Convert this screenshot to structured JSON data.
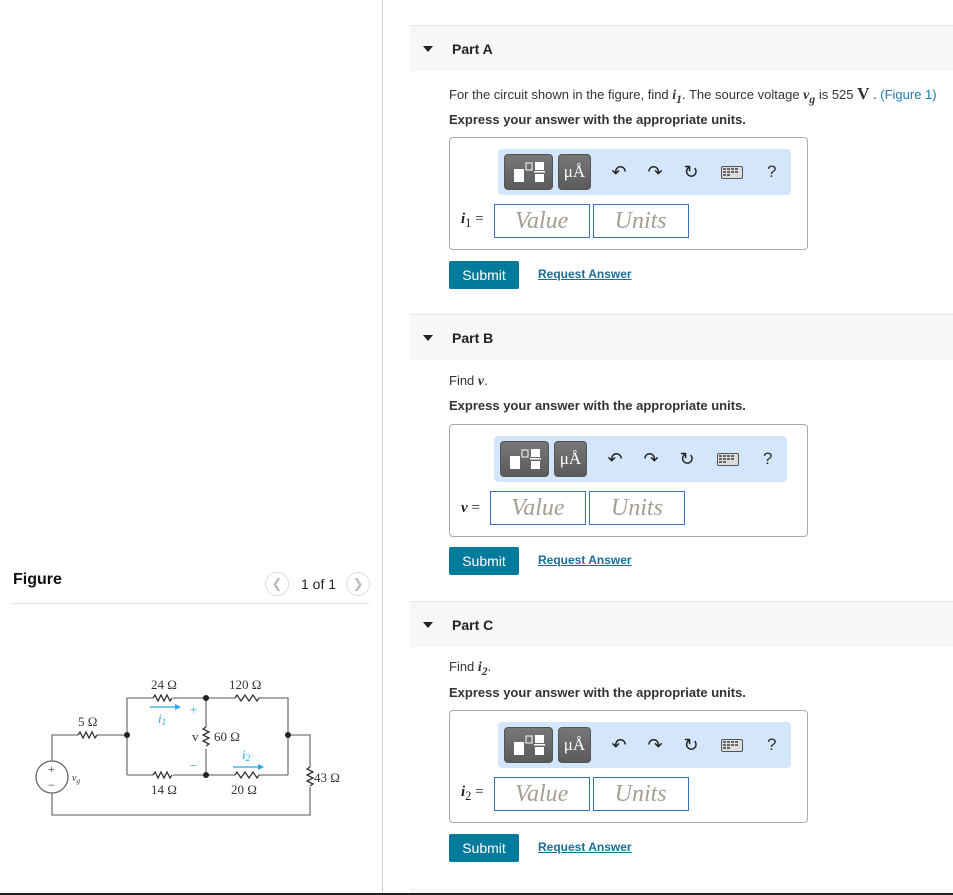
{
  "figure": {
    "title": "Figure",
    "pager": "1 of 1",
    "prev_icon": "chevron-left-icon",
    "next_icon": "chevron-right-icon",
    "circuit_labels": {
      "r5": "5 Ω",
      "r24": "24 Ω",
      "r120": "120 Ω",
      "r60": "60 Ω",
      "r14": "14 Ω",
      "r20": "20 Ω",
      "r43": "43 Ω",
      "i1": "i",
      "i1_sub": "1",
      "i2": "i",
      "i2_sub": "2",
      "v": "v",
      "plus": "+",
      "minus": "−",
      "vg": "v",
      "vg_sub": "g"
    },
    "accent_color": "#29a9e0"
  },
  "toolbar": {
    "units_label": "μÅ",
    "undo_icon": "↶",
    "redo_icon": "↷",
    "reset_icon": "↻",
    "help_label": "?"
  },
  "parts": [
    {
      "title": "Part A",
      "prompt_pre": "For the circuit shown in the figure, find ",
      "prompt_var": "i",
      "prompt_var_sub": "1",
      "prompt_mid": ". The source voltage ",
      "prompt_var2": "v",
      "prompt_var2_sub": "g",
      "prompt_mid2": " is 525 ",
      "prompt_unit": "V",
      "prompt_post": " . ",
      "figure_link": "(Figure 1)",
      "instruction": "Express your answer with the appropriate units.",
      "answer_label": "i",
      "answer_sub": "1",
      "value_placeholder": "Value",
      "units_placeholder": "Units",
      "submit": "Submit",
      "request": "Request Answer"
    },
    {
      "title": "Part B",
      "prompt_pre": "Find ",
      "prompt_var": "v",
      "prompt_post": ".",
      "instruction": "Express your answer with the appropriate units.",
      "answer_label": "v",
      "value_placeholder": "Value",
      "units_placeholder": "Units",
      "submit": "Submit",
      "request": "Request Answer"
    },
    {
      "title": "Part C",
      "prompt_pre": "Find ",
      "prompt_var": "i",
      "prompt_var_sub": "2",
      "prompt_post": ".",
      "instruction": "Express your answer with the appropriate units.",
      "answer_label": "i",
      "answer_sub": "2",
      "value_placeholder": "Value",
      "units_placeholder": "Units",
      "submit": "Submit",
      "request": "Request Answer"
    }
  ],
  "colors": {
    "submit_bg": "#027b9c",
    "link": "#1c7ab3",
    "toolbar_bg": "#d4e6fb",
    "field_border": "#3d6fc1"
  }
}
